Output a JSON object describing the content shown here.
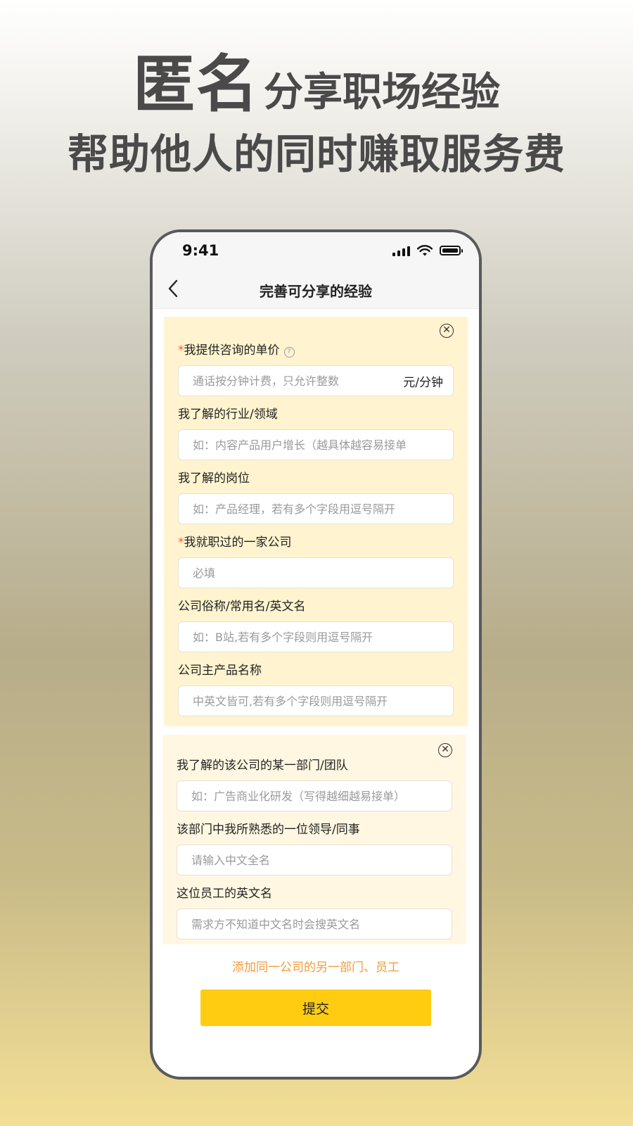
{
  "hero": {
    "big": "匿名",
    "small": "分享职场经验",
    "line2": "帮助他人的同时赚取服务费"
  },
  "status_bar": {
    "time": "9:41"
  },
  "navbar": {
    "back_icon": "chevron-left-icon",
    "title": "完善可分享的经验"
  },
  "card1": {
    "fields": [
      {
        "required": true,
        "label": "我提供咨询的单价",
        "help_icon": "question-circle-icon",
        "placeholder": "通话按分钟计费，只允许整数",
        "unit": "元/分钟"
      },
      {
        "required": false,
        "label": "我了解的行业/领域",
        "placeholder": "如：内容产品用户增长（越具体越容易接单"
      },
      {
        "required": false,
        "label": "我了解的岗位",
        "placeholder": "如：产品经理，若有多个字段用逗号隔开"
      },
      {
        "required": true,
        "label": "我就职过的一家公司",
        "placeholder": "必填"
      },
      {
        "required": false,
        "label": "公司俗称/常用名/英文名",
        "placeholder": "如：B站,若有多个字段则用逗号隔开"
      },
      {
        "required": false,
        "label": "公司主产品名称",
        "placeholder": "中英文皆可,若有多个字段则用逗号隔开"
      }
    ]
  },
  "card2": {
    "fields": [
      {
        "label": "我了解的该公司的某一部门/团队",
        "placeholder": "如：广告商业化研发（写得越细越易接单）"
      },
      {
        "label": "该部门中我所熟悉的一位领导/同事",
        "placeholder": "请输入中文全名"
      },
      {
        "label": "这位员工的英文名",
        "placeholder": "需求方不知道中文名时会搜英文名"
      }
    ]
  },
  "add_link": "添加同一公司的另一部门、员工",
  "submit_label": "提交",
  "colors": {
    "accent": "#ffcc12",
    "link": "#f39b3a",
    "required": "#ff5a3c",
    "card1_bg": "#fff4cf",
    "card2_bg": "#fff7e2"
  }
}
